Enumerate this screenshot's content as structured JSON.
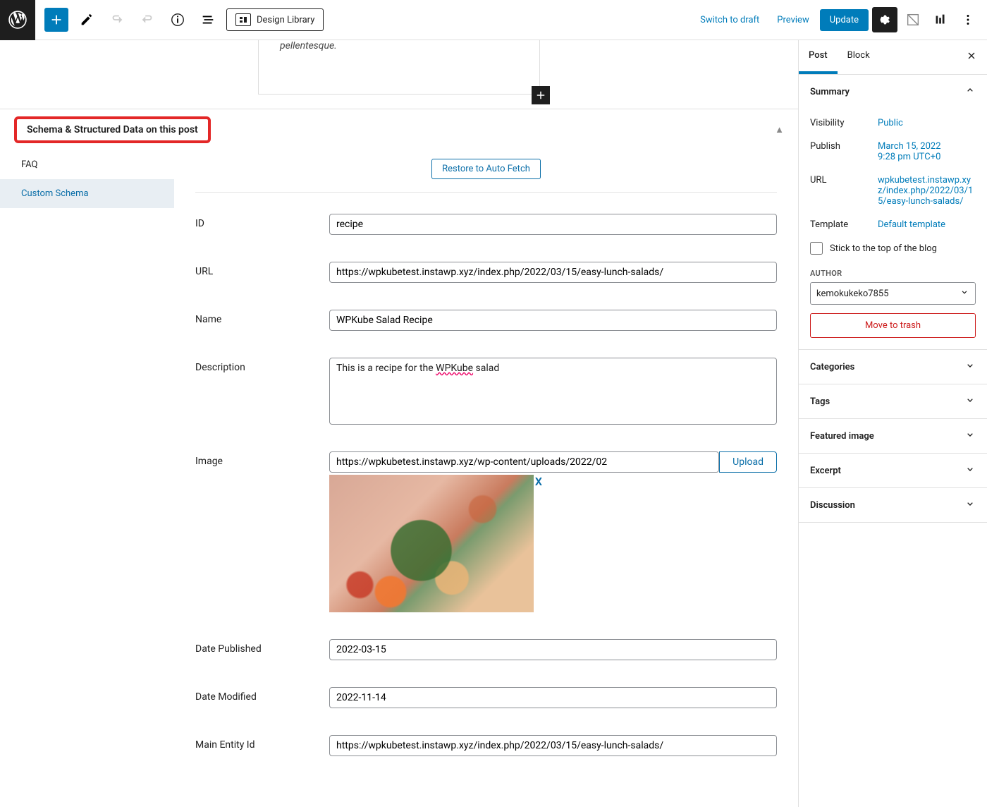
{
  "toolbar": {
    "design_library": "Design Library",
    "switch_to_draft": "Switch to draft",
    "preview": "Preview",
    "update": "Update"
  },
  "editor": {
    "preview_text": "pellentesque."
  },
  "schema": {
    "panel_title": "Schema & Structured Data on this post",
    "nav": {
      "faq": "FAQ",
      "custom_schema": "Custom Schema"
    },
    "restore_button": "Restore to Auto Fetch",
    "fields": {
      "id": {
        "label": "ID",
        "value": "recipe"
      },
      "url": {
        "label": "URL",
        "value": "https://wpkubetest.instawp.xyz/index.php/2022/03/15/easy-lunch-salads/"
      },
      "name": {
        "label": "Name",
        "value": "WPKube Salad Recipe"
      },
      "description": {
        "label": "Description",
        "value_pre": "This is a recipe for the ",
        "value_underlined": "WPKube",
        "value_post": " salad"
      },
      "image": {
        "label": "Image",
        "value": "https://wpkubetest.instawp.xyz/wp-content/uploads/2022/02",
        "upload": "Upload",
        "remove": "X"
      },
      "date_published": {
        "label": "Date Published",
        "value": "2022-03-15"
      },
      "date_modified": {
        "label": "Date Modified",
        "value": "2022-11-14"
      },
      "main_entity_id": {
        "label": "Main Entity Id",
        "value": "https://wpkubetest.instawp.xyz/index.php/2022/03/15/easy-lunch-salads/"
      }
    }
  },
  "sidebar": {
    "tabs": {
      "post": "Post",
      "block": "Block"
    },
    "summary": {
      "title": "Summary",
      "visibility": {
        "label": "Visibility",
        "value": "Public"
      },
      "publish": {
        "label": "Publish",
        "date": "March 15, 2022",
        "time": "9:28 pm UTC+0"
      },
      "url": {
        "label": "URL",
        "value": "wpkubetest.instawp.xyz/index.php/2022/03/15/easy-lunch-salads/"
      },
      "template": {
        "label": "Template",
        "value": "Default template"
      },
      "stick": "Stick to the top of the blog",
      "author_label": "AUTHOR",
      "author": "kemokukeko7855",
      "trash": "Move to trash"
    },
    "sections": {
      "categories": "Categories",
      "tags": "Tags",
      "featured_image": "Featured image",
      "excerpt": "Excerpt",
      "discussion": "Discussion"
    }
  }
}
